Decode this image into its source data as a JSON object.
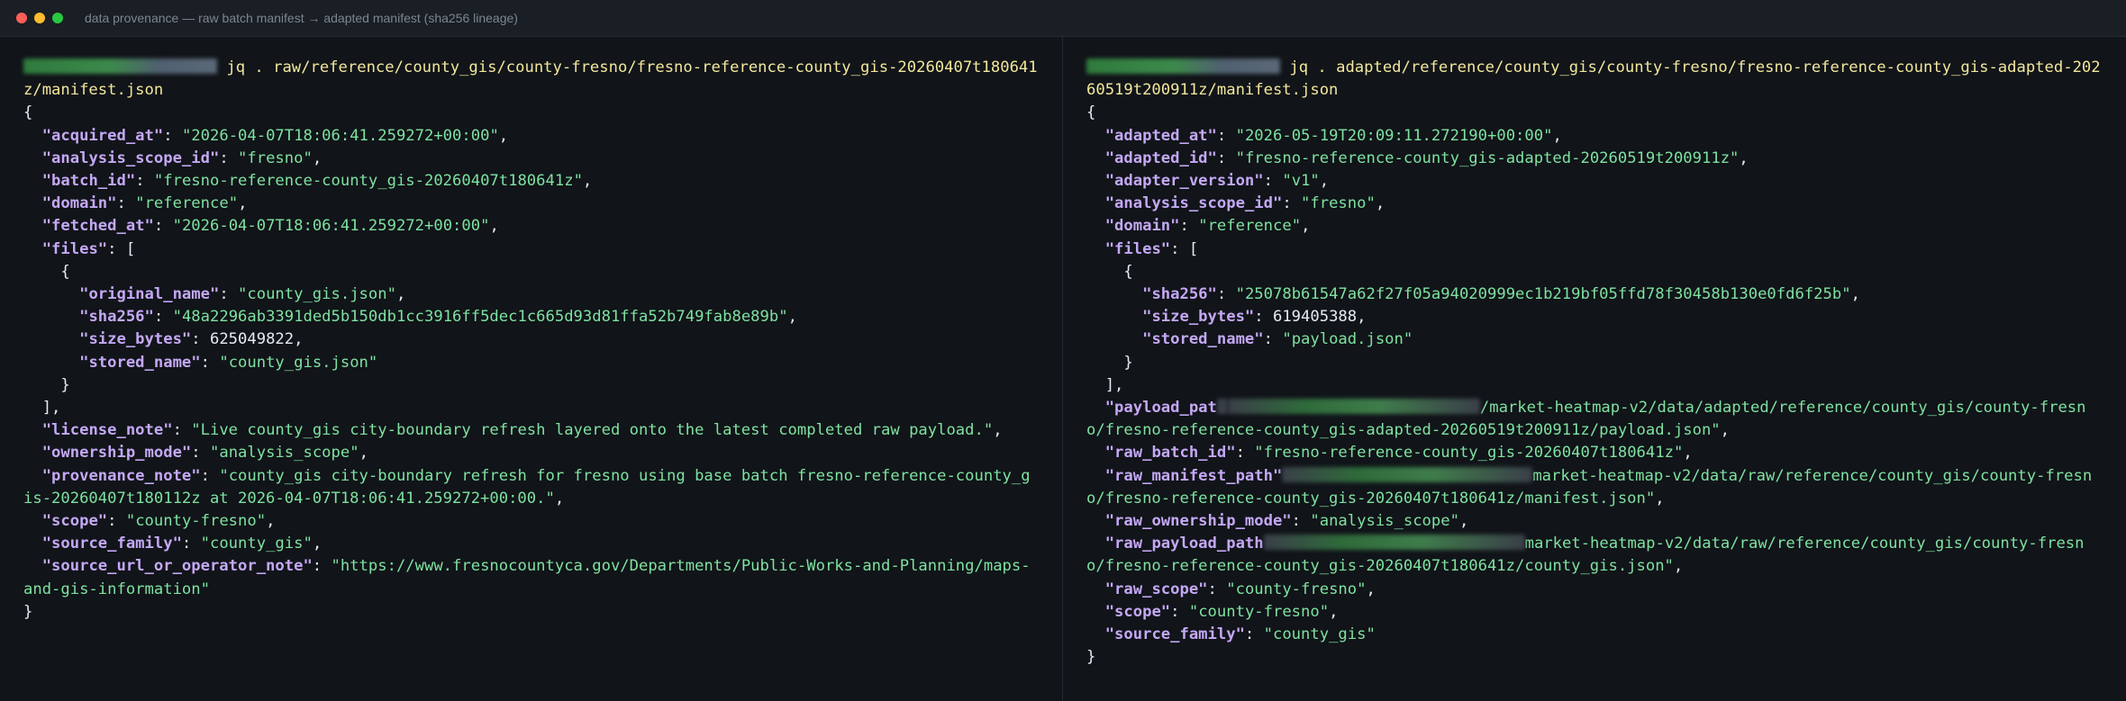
{
  "window": {
    "title": "data provenance — raw batch manifest → adapted manifest (sha256 lineage)"
  },
  "left": {
    "command": "jq . raw/reference/county_gis/county-fresno/fresno-reference-county_gis-20260407t180641z/manifest.json",
    "fields": {
      "acquired_at": "2026-04-07T18:06:41.259272+00:00",
      "analysis_scope_id": "fresno",
      "batch_id": "fresno-reference-county_gis-20260407t180641z",
      "domain": "reference",
      "fetched_at": "2026-04-07T18:06:41.259272+00:00",
      "file_original_name": "county_gis.json",
      "file_sha256": "48a2296ab3391ded5b150db1cc3916ff5dec1c665d93d81ffa52b749fab8e89b",
      "file_size_bytes": "625049822",
      "file_stored_name": "county_gis.json",
      "license_note": "Live county_gis city-boundary refresh layered onto the latest completed raw payload.",
      "ownership_mode": "analysis_scope",
      "provenance_note": "county_gis city-boundary refresh for fresno using base batch fresno-reference-county_gis-20260407t180112z at 2026-04-07T18:06:41.259272+00:00.",
      "scope": "county-fresno",
      "source_family": "county_gis",
      "source_url_or_operator_note": "https://www.fresnocountyca.gov/Departments/Public-Works-and-Planning/maps-and-gis-information"
    }
  },
  "right": {
    "command": "jq . adapted/reference/county_gis/county-fresno/fresno-reference-county_gis-adapted-20260519t200911z/manifest.json",
    "fields": {
      "adapted_at": "2026-05-19T20:09:11.272190+00:00",
      "adapted_id": "fresno-reference-county_gis-adapted-20260519t200911z",
      "adapter_version": "v1",
      "analysis_scope_id": "fresno",
      "domain": "reference",
      "file_sha256": "25078b61547a62f27f05a94020999ec1b219bf05ffd78f30458b130e0fd6f25b",
      "file_size_bytes": "619405388",
      "file_stored_name": "payload.json",
      "payload_path_tail": "/market-heatmap-v2/data/adapted/reference/county_gis/county-fresno/fresno-reference-county_gis-adapted-20260519t200911z/payload.json\"",
      "raw_batch_id": "fresno-reference-county_gis-20260407t180641z",
      "raw_manifest_path_tail": "market-heatmap-v2/data/raw/reference/county_gis/county-fresno/fresno-reference-county_gis-20260407t180641z/manifest.json\"",
      "raw_ownership_mode": "analysis_scope",
      "raw_payload_path_tail": "market-heatmap-v2/data/raw/reference/county_gis/county-fresno/fresno-reference-county_gis-20260407t180641z/county_gis.json\"",
      "raw_scope": "county-fresno",
      "scope": "county-fresno",
      "source_family": "county_gis"
    }
  }
}
